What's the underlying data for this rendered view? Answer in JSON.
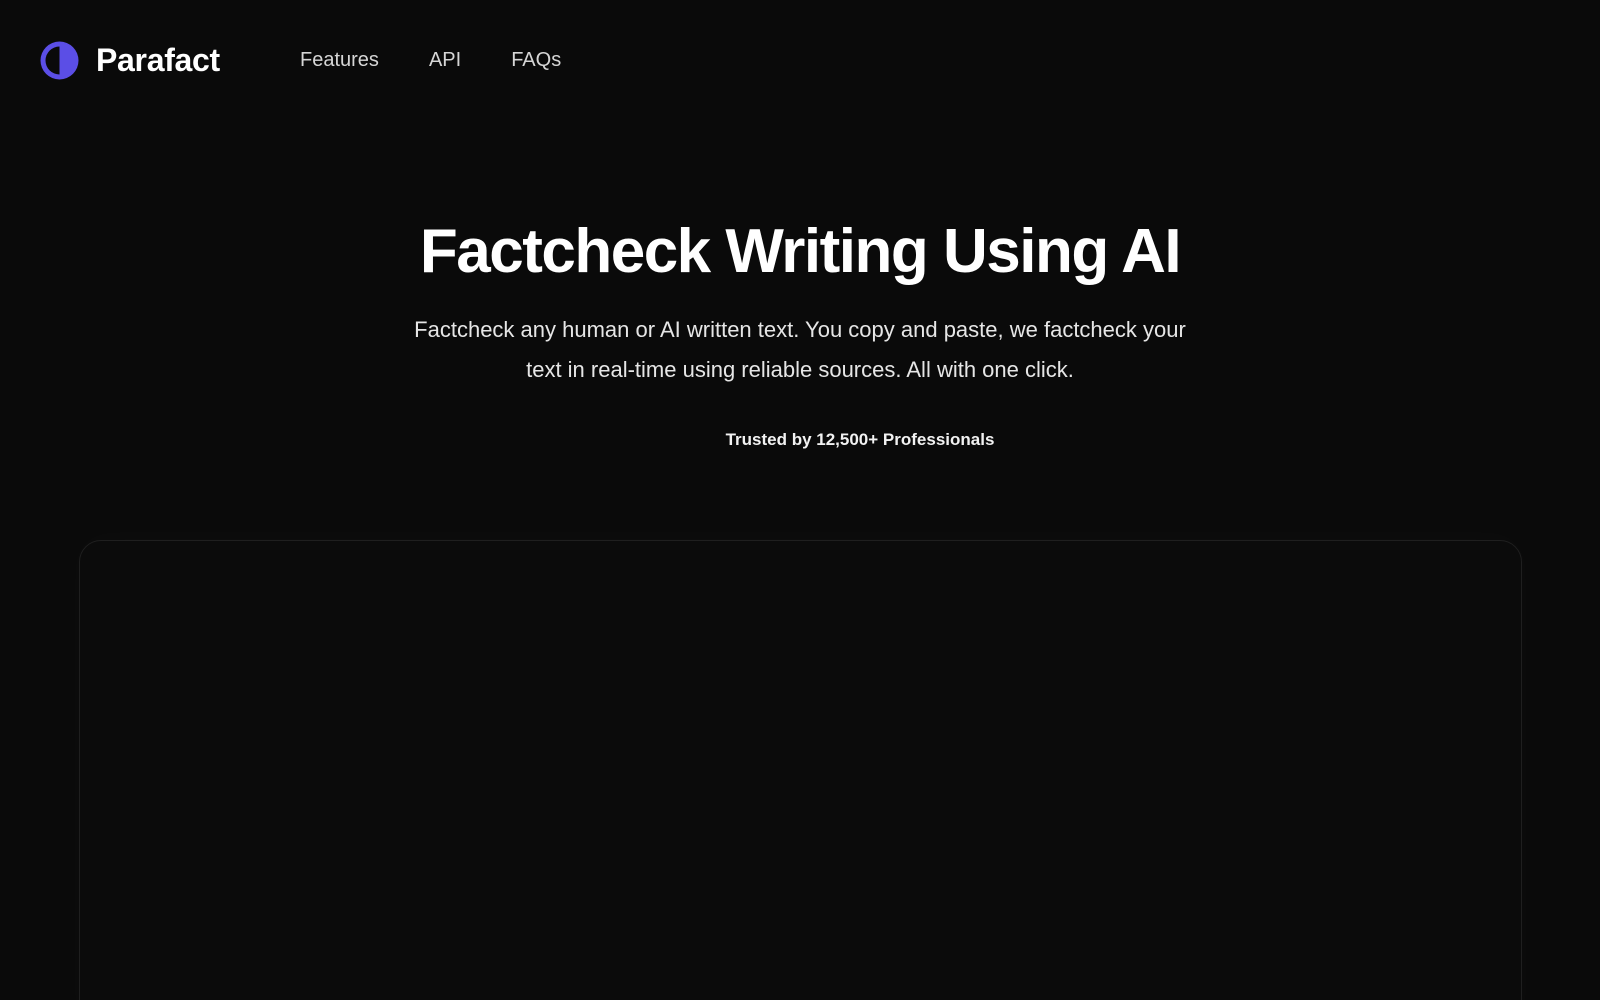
{
  "brand": {
    "name": "Parafact",
    "logo_icon": "half-circle-logo-icon",
    "accent_color": "#5b4ee6"
  },
  "nav": {
    "items": [
      {
        "label": "Features"
      },
      {
        "label": "API"
      },
      {
        "label": "FAQs"
      }
    ]
  },
  "hero": {
    "title": "Factcheck Writing Using AI",
    "subtitle": "Factcheck any human or AI written text. You copy and paste, we factcheck your text in real-time using reliable sources. All with one click.",
    "trusted": "Trusted by 12,500+ Professionals"
  },
  "colors": {
    "background": "#0a0a0a",
    "text": "#ffffff",
    "muted_text": "#d6d6d6",
    "frame_border": "#1f1f1f"
  }
}
